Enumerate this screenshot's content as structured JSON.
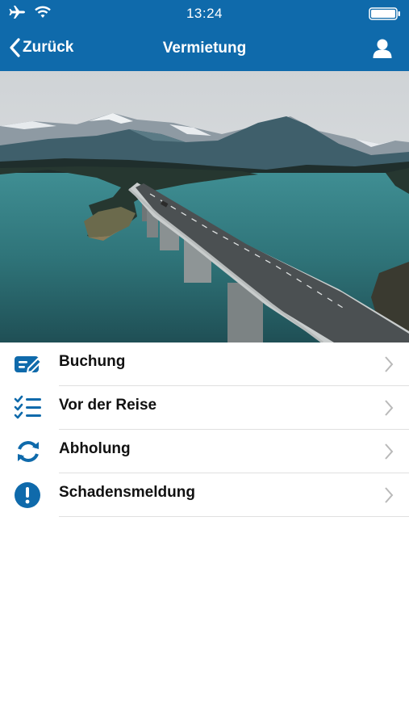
{
  "status_bar": {
    "time": "13:24",
    "icons": [
      "airplane-icon",
      "wifi-icon",
      "battery-icon"
    ]
  },
  "nav": {
    "back_label": "Zurück",
    "title": "Vermietung",
    "profile_icon": "user-icon"
  },
  "hero": {
    "description_icon": "bridge-landscape-photo"
  },
  "menu": {
    "items": [
      {
        "label": "Buchung",
        "icon": "edit-card-icon"
      },
      {
        "label": "Vor der Reise",
        "icon": "checklist-icon"
      },
      {
        "label": "Abholung",
        "icon": "sync-icon"
      },
      {
        "label": "Schadensmeldung",
        "icon": "alert-icon"
      }
    ]
  },
  "colors": {
    "brand": "#0f6aab",
    "text": "#111111",
    "divider": "#e0e0e0",
    "chevron": "#b9b9b9"
  }
}
